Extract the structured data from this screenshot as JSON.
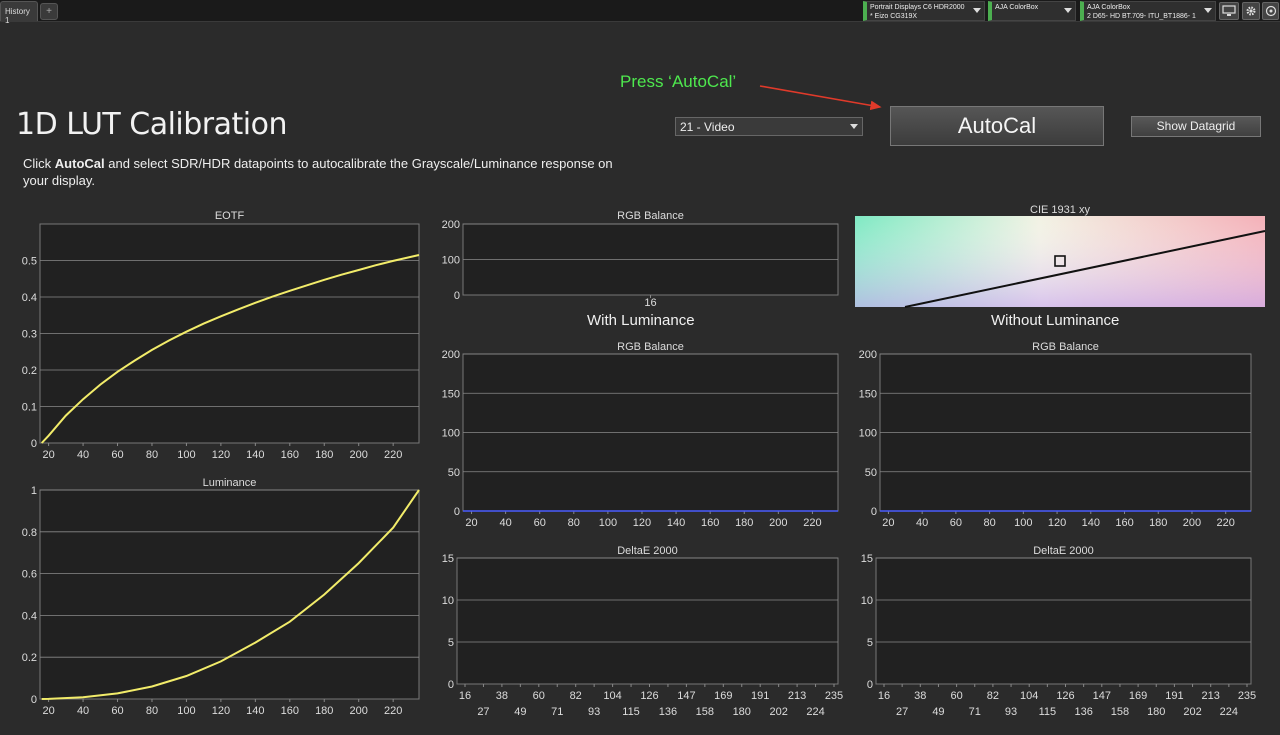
{
  "tabs": [
    {
      "label": "History 1"
    }
  ],
  "tab_add_label": "+",
  "devices": [
    {
      "line1": "Portrait Displays C6 HDR2000",
      "line2": "* Eizo CG319X"
    },
    {
      "line1": "AJA ColorBox",
      "line2": ""
    },
    {
      "line1": "AJA ColorBox",
      "line2": "2 D65- HD BT.709- ITU_BT1886- 1"
    }
  ],
  "toolbar_icons": [
    "monitor-icon",
    "gear-icon",
    "help-icon"
  ],
  "title": "1D LUT Calibration",
  "description": {
    "prefix": "Click ",
    "bold": "AutoCal",
    "suffix": " and select SDR/HDR datapoints to autocalibrate the Grayscale/Luminance response on your display."
  },
  "instruction": "Press ‘AutoCal’",
  "arrow_color": "#e03a2a",
  "preset": "21 - Video",
  "autocal_label": "AutoCal",
  "datagrid_label": "Show Datagrid",
  "section_with": "With Luminance",
  "section_without": "Without Luminance",
  "colors": {
    "curve": "#f2ec6a",
    "baseline": "#4a5cff",
    "plot_bg": "#212121",
    "grid": "#8a8a8a"
  },
  "chart_data": [
    {
      "id": "eotf",
      "type": "line",
      "title": "EOTF",
      "xlim": [
        15,
        235
      ],
      "ylim": [
        0,
        0.6
      ],
      "xticks": [
        20,
        40,
        60,
        80,
        100,
        120,
        140,
        160,
        180,
        200,
        220
      ],
      "yticks": [
        0,
        0.1,
        0.2,
        0.3,
        0.4,
        0.5
      ],
      "series": [
        {
          "x": [
            16,
            20,
            30,
            40,
            50,
            60,
            70,
            80,
            90,
            100,
            110,
            120,
            130,
            140,
            150,
            160,
            170,
            180,
            190,
            200,
            210,
            220,
            235
          ],
          "y": [
            0,
            0.02,
            0.075,
            0.12,
            0.16,
            0.195,
            0.226,
            0.255,
            0.281,
            0.305,
            0.327,
            0.347,
            0.366,
            0.384,
            0.401,
            0.417,
            0.432,
            0.447,
            0.461,
            0.474,
            0.487,
            0.499,
            0.515
          ]
        }
      ]
    },
    {
      "id": "luminance",
      "type": "line",
      "title": "Luminance",
      "xlim": [
        15,
        235
      ],
      "ylim": [
        0,
        1
      ],
      "xticks": [
        20,
        40,
        60,
        80,
        100,
        120,
        140,
        160,
        180,
        200,
        220
      ],
      "yticks": [
        0,
        0.2,
        0.4,
        0.6,
        0.8,
        1
      ],
      "series": [
        {
          "x": [
            16,
            20,
            40,
            60,
            80,
            100,
            120,
            140,
            160,
            180,
            200,
            220,
            235
          ],
          "y": [
            0,
            0.0003,
            0.008,
            0.027,
            0.06,
            0.11,
            0.18,
            0.27,
            0.37,
            0.5,
            0.65,
            0.82,
            1.0
          ]
        }
      ]
    },
    {
      "id": "rgb-top",
      "type": "line",
      "title": "RGB Balance",
      "categories": [
        "16"
      ],
      "ylim": [
        0,
        200
      ],
      "yticks": [
        0,
        100,
        200
      ],
      "series": []
    },
    {
      "id": "rgb-with",
      "type": "line",
      "title": "RGB Balance",
      "xlim": [
        15,
        235
      ],
      "ylim": [
        0,
        200
      ],
      "xticks": [
        20,
        40,
        60,
        80,
        100,
        120,
        140,
        160,
        180,
        200,
        220
      ],
      "yticks": [
        0,
        50,
        100,
        150,
        200
      ],
      "series": [
        {
          "x": [
            15,
            235
          ],
          "y": [
            0,
            0
          ]
        }
      ]
    },
    {
      "id": "rgb-without",
      "type": "line",
      "title": "RGB Balance",
      "xlim": [
        15,
        235
      ],
      "ylim": [
        0,
        200
      ],
      "xticks": [
        20,
        40,
        60,
        80,
        100,
        120,
        140,
        160,
        180,
        200,
        220
      ],
      "yticks": [
        0,
        50,
        100,
        150,
        200
      ],
      "series": [
        {
          "x": [
            15,
            235
          ],
          "y": [
            0,
            0
          ]
        }
      ]
    },
    {
      "id": "de-with",
      "type": "bar",
      "title": "DeltaE 2000",
      "categories": [
        "16",
        "27",
        "38",
        "49",
        "60",
        "71",
        "82",
        "93",
        "104",
        "115",
        "126",
        "136",
        "147",
        "158",
        "169",
        "180",
        "191",
        "202",
        "213",
        "224",
        "235"
      ],
      "ylim": [
        0,
        15
      ],
      "yticks": [
        0,
        5,
        10,
        15
      ],
      "series": []
    },
    {
      "id": "de-without",
      "type": "bar",
      "title": "DeltaE 2000",
      "categories": [
        "16",
        "27",
        "38",
        "49",
        "60",
        "71",
        "82",
        "93",
        "104",
        "115",
        "126",
        "136",
        "147",
        "158",
        "169",
        "180",
        "191",
        "202",
        "213",
        "224",
        "235"
      ],
      "ylim": [
        0,
        15
      ],
      "yticks": [
        0,
        5,
        10,
        15
      ],
      "series": []
    },
    {
      "id": "cie",
      "type": "scatter",
      "title": "CIE 1931 xy",
      "series": []
    }
  ]
}
